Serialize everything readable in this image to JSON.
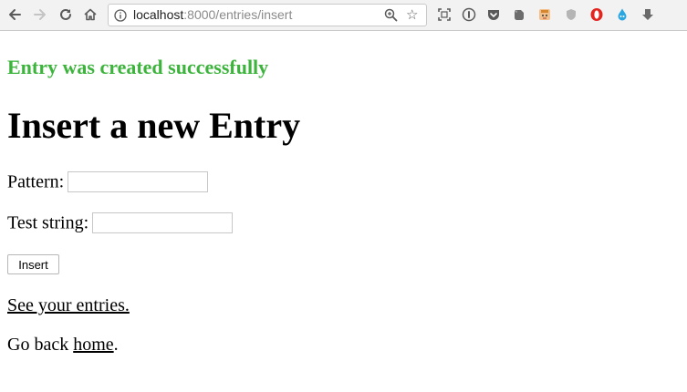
{
  "browser": {
    "url_host": "localhost",
    "url_path": ":8000/entries/insert",
    "icons": {
      "back": "arrow-left-icon",
      "forward": "arrow-right-icon",
      "reload": "reload-icon",
      "home": "home-icon",
      "info": "info-icon",
      "zoom": "zoom-icon",
      "bookmark": "star-icon"
    },
    "extensions": [
      "screenshot-icon",
      "password-icon",
      "pocket-icon",
      "evernote-icon",
      "face-extension-icon",
      "shield-icon",
      "opera-icon",
      "drop-icon",
      "download-icon"
    ]
  },
  "flash": {
    "message": "Entry was created successfully",
    "color": "#3cb43c"
  },
  "page": {
    "title": "Insert a new Entry"
  },
  "form": {
    "pattern_label": "Pattern:",
    "pattern_value": "",
    "test_string_label": "Test string:",
    "test_string_value": "",
    "submit_label": "Insert"
  },
  "links": {
    "see_entries": "See your entries.",
    "go_back_prefix": "Go back ",
    "home_link": "home",
    "go_back_suffix": "."
  }
}
